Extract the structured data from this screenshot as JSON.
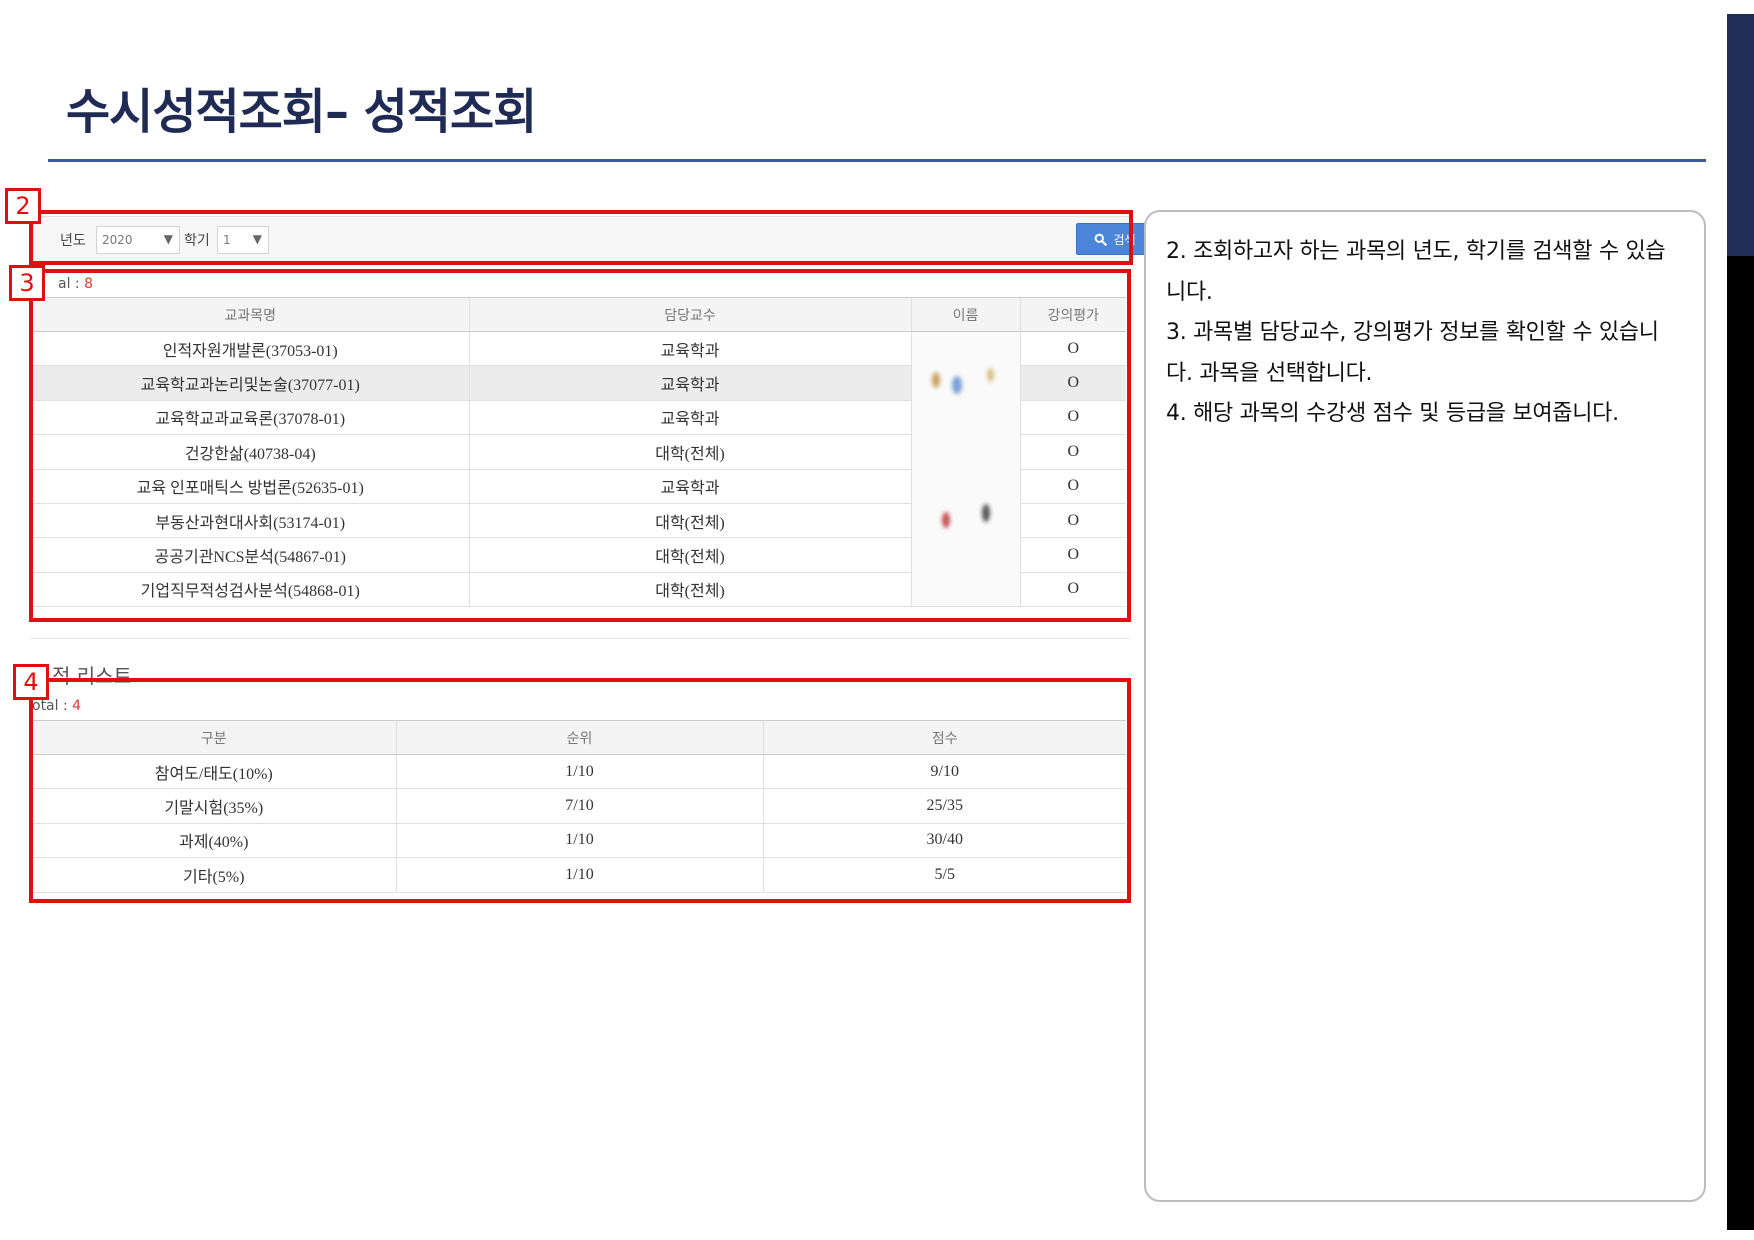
{
  "title": "수시성적조회– 성적조회",
  "search": {
    "year_label": "년도",
    "year_value": "2020",
    "semester_label": "학기",
    "semester_value": "1",
    "button_label": "검색"
  },
  "markers": [
    "2",
    "3",
    "4"
  ],
  "course_table": {
    "total_label": "al : ",
    "total_count": "8",
    "headers": [
      "교과목명",
      "담당교수",
      "이름",
      "강의평가"
    ],
    "rows": [
      {
        "name": "인적자원개발론(37053-01)",
        "professor": "교육학과",
        "evaluation": "O"
      },
      {
        "name": "교육학교과논리및논술(37077-01)",
        "professor": "교육학과",
        "evaluation": "O"
      },
      {
        "name": "교육학교과교육론(37078-01)",
        "professor": "교육학과",
        "evaluation": "O"
      },
      {
        "name": "건강한삶(40738-04)",
        "professor": "대학(전체)",
        "evaluation": "O"
      },
      {
        "name": "교육 인포매틱스 방법론(52635-01)",
        "professor": "교육학과",
        "evaluation": "O"
      },
      {
        "name": "부동산과현대사회(53174-01)",
        "professor": "대학(전체)",
        "evaluation": "O"
      },
      {
        "name": "공공기관NCS분석(54867-01)",
        "professor": "대학(전체)",
        "evaluation": "O"
      },
      {
        "name": "기업직무적성검사분석(54868-01)",
        "professor": "대학(전체)",
        "evaluation": "O"
      }
    ]
  },
  "score_section": {
    "heading": "적 리스트",
    "total_label": "otal : ",
    "total_count": "4",
    "headers": [
      "구분",
      "순위",
      "점수"
    ],
    "rows": [
      {
        "category": "참여도/태도(10%)",
        "rank": "1/10",
        "score": "9/10"
      },
      {
        "category": "기말시험(35%)",
        "rank": "7/10",
        "score": "25/35"
      },
      {
        "category": "과제(40%)",
        "rank": "1/10",
        "score": "30/40"
      },
      {
        "category": "기타(5%)",
        "rank": "1/10",
        "score": "5/5"
      }
    ]
  },
  "description": [
    "2. 조회하고자 하는 과목의 년도, 학기를 검색할 수 있습니다.",
    "3. 과목별 담당교수, 강의평가 정보를 확인할 수 있습니다. 과목을 선택합니다.",
    "4. 해당 과목의 수강생 점수 및 등급을 보여줍니다."
  ],
  "colors": {
    "title": "#1f2a55",
    "rule": "#3c5a9a",
    "highlight_box": "#e01010",
    "search_button": "#4d86d8",
    "total_count": "#e03a3a"
  }
}
